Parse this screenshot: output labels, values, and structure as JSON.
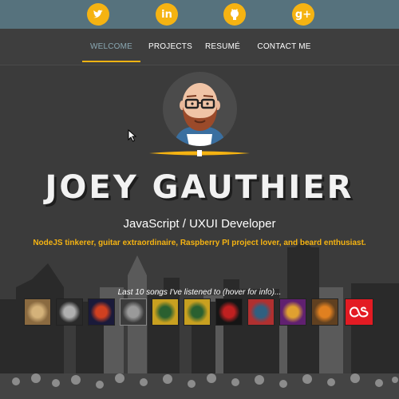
{
  "social": [
    {
      "name": "twitter",
      "icon": "twitter-icon",
      "glyph": ""
    },
    {
      "name": "linkedin",
      "icon": "linkedin-icon",
      "glyph": "in"
    },
    {
      "name": "github",
      "icon": "github-icon",
      "glyph": ""
    },
    {
      "name": "google-plus",
      "icon": "google-plus-icon",
      "glyph": "g+"
    }
  ],
  "nav": {
    "items": [
      {
        "label": "WELCOME",
        "active": true
      },
      {
        "label": "PROJECTS",
        "active": false
      },
      {
        "label": "RESUMÉ",
        "active": false
      },
      {
        "label": "CONTACT ME",
        "active": false
      }
    ]
  },
  "hero": {
    "name": "JOEY GAUTHIER",
    "role": "JavaScript / UXUI Developer",
    "tagline": "NodeJS tinkerer, guitar extraordinaire, Raspberry PI project lover, and beard enthusiast."
  },
  "songs": {
    "label": "Last 10 songs I've listened to (hover for info)...",
    "albums": [
      {
        "color": "#8a6a40",
        "accent": "#d4b27a"
      },
      {
        "color": "#2a2a2a",
        "accent": "#b0b0b0"
      },
      {
        "color": "#1a1a3a",
        "accent": "#d04020"
      },
      {
        "color": "#3b3b3b",
        "accent": "#9a9a9a"
      },
      {
        "color": "#c8a020",
        "accent": "#2a6030"
      },
      {
        "color": "#c8a020",
        "accent": "#2a6030"
      },
      {
        "color": "#151515",
        "accent": "#c02020"
      },
      {
        "color": "#b03030",
        "accent": "#306080"
      },
      {
        "color": "#602070",
        "accent": "#e0a030"
      },
      {
        "color": "#604020",
        "accent": "#e08020"
      }
    ],
    "service_icon": "lastfm-icon"
  },
  "colors": {
    "accent": "#f5b312",
    "social_bar": "#56727d",
    "background": "#3b3b3b",
    "lastfm": "#e31b23"
  }
}
